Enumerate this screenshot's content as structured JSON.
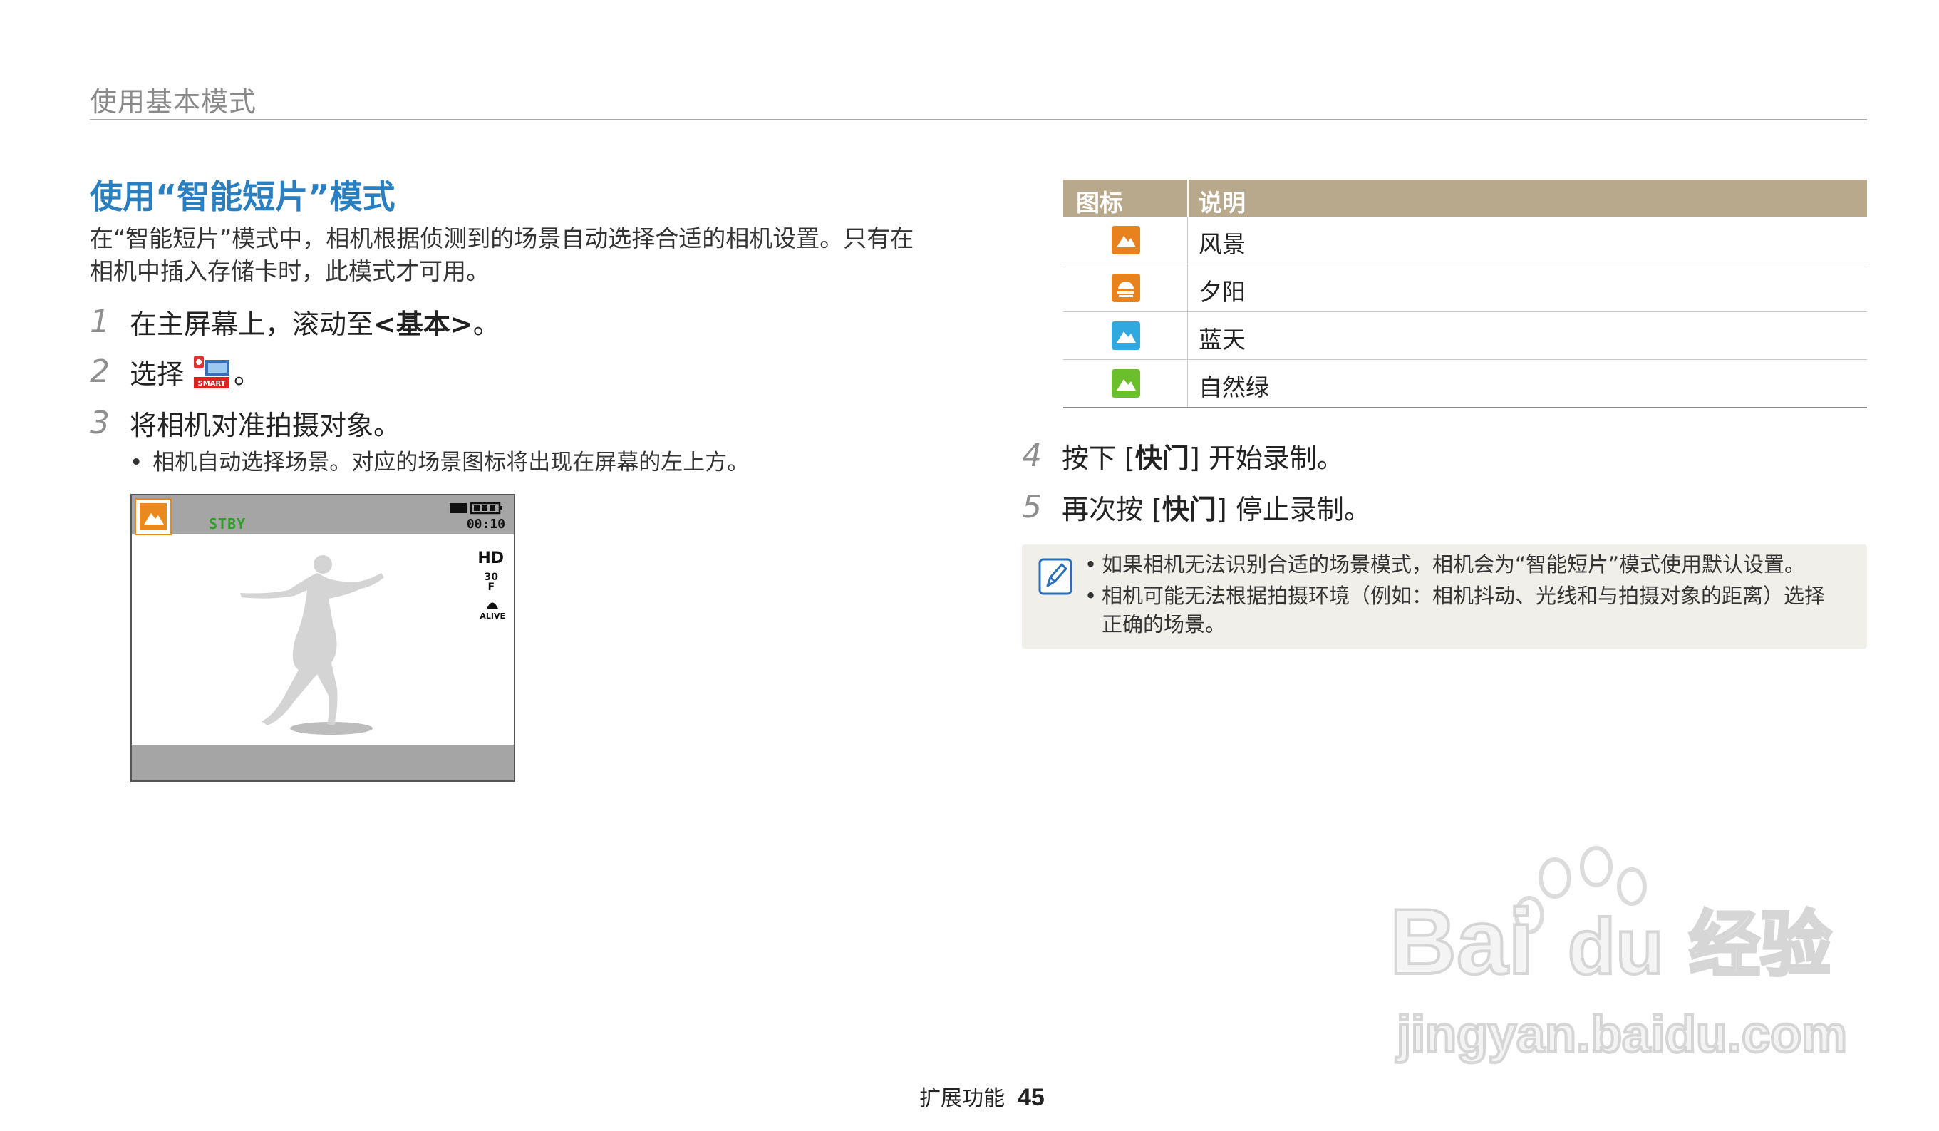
{
  "header": {
    "section": "使用基本模式"
  },
  "title": "使用“智能短片”模式",
  "intro": "在“智能短片”模式中，相机根据侦测到的场景自动选择合适的相机设置。只有在相机中插入存储卡时，此模式才可用。",
  "steps_left": [
    {
      "num": "1",
      "pre": "在主屏幕上，滚动至",
      "bold": "<基本>",
      "post": "。"
    },
    {
      "num": "2",
      "pre": "选择 ",
      "icon": "smart-movie-icon",
      "post": "。"
    },
    {
      "num": "3",
      "pre": "将相机对准拍摄对象。"
    }
  ],
  "bullet_left": "相机自动选择场景。对应的场景图标将出现在屏幕的左上方。",
  "camera_screen": {
    "status": "STBY",
    "time": "00:10",
    "quality": "HD",
    "fps_top": "30",
    "fps_icon": "F",
    "alive": "ALIVE",
    "scene_icon_color": "#ea8a1e"
  },
  "table": {
    "headers": [
      "图标",
      "说明"
    ],
    "header_color": "#b8a98d",
    "rows": [
      {
        "icon": "landscape-icon",
        "color": "#e8821c",
        "label": "风景"
      },
      {
        "icon": "sunset-icon",
        "color": "#e8821c",
        "label": "夕阳"
      },
      {
        "icon": "blue-sky-icon",
        "color": "#31a8e0",
        "label": "蓝天"
      },
      {
        "icon": "natural-green-icon",
        "color": "#6cbf2c",
        "label": "自然绿"
      }
    ]
  },
  "steps_right": [
    {
      "num": "4",
      "pre": "按下 [",
      "bold": "快门",
      "post": "] 开始录制。"
    },
    {
      "num": "5",
      "pre": "再次按 [",
      "bold": "快门",
      "post": "] 停止录制。"
    }
  ],
  "note": {
    "icon": "note-pencil-icon",
    "items": [
      "如果相机无法识别合适的场景模式，相机会为“智能短片”模式使用默认设置。",
      "相机可能无法根据拍摄环境（例如：相机抖动、光线和与拍摄对象的距离）选择正确的场景。"
    ]
  },
  "watermark": {
    "brand": "Bai du 经验",
    "url": "jingyan.baidu.com"
  },
  "footer": {
    "section": "扩展功能",
    "page": "45"
  }
}
